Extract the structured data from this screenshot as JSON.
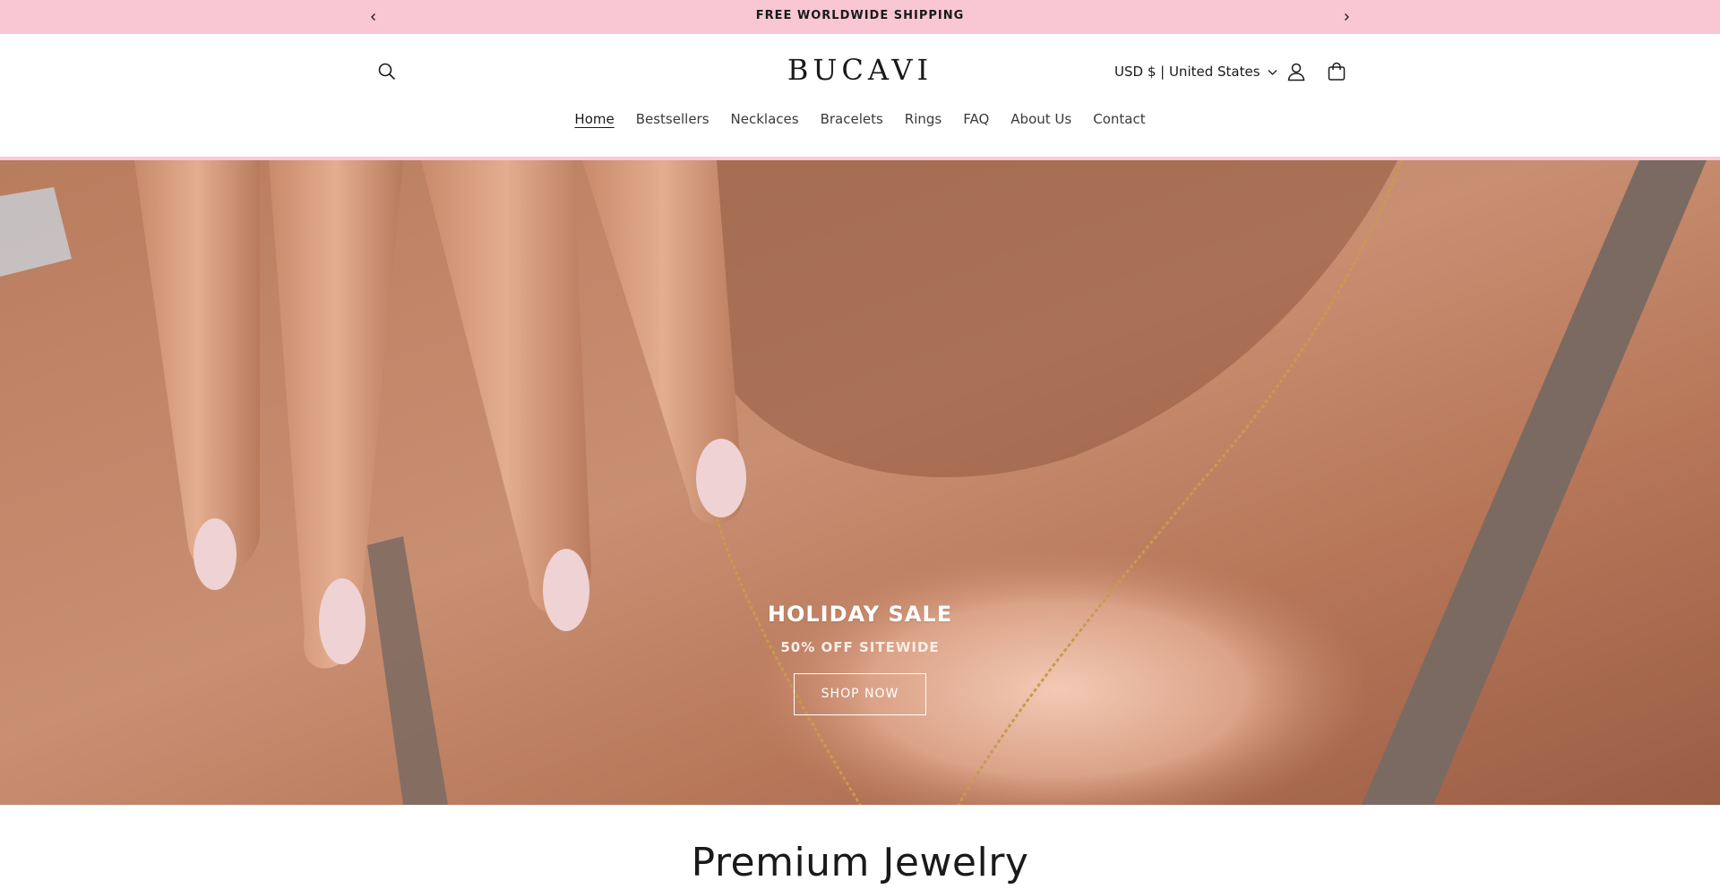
{
  "announcement": {
    "message": "FREE WORLDWIDE SHIPPING",
    "prev_icon": "chevron-left-icon",
    "next_icon": "chevron-right-icon"
  },
  "header": {
    "logo": "BUCAVI",
    "currency_label": "USD $ | United States",
    "icons": [
      "search-icon",
      "account-icon",
      "cart-icon",
      "chevron-down-icon"
    ]
  },
  "nav": {
    "items": [
      "Home",
      "Bestsellers",
      "Necklaces",
      "Bracelets",
      "Rings",
      "FAQ",
      "About Us",
      "Contact"
    ],
    "active": "Home"
  },
  "hero": {
    "title": "HOLIDAY SALE",
    "subtitle": "50% OFF SITEWIDE",
    "button_label": "SHOP NOW"
  },
  "section": {
    "title": "Premium Jewelry"
  },
  "colors": {
    "announcement_bg": "#f9c6d4",
    "accent_line": "#f7cad6",
    "text": "#1a1a1a"
  }
}
